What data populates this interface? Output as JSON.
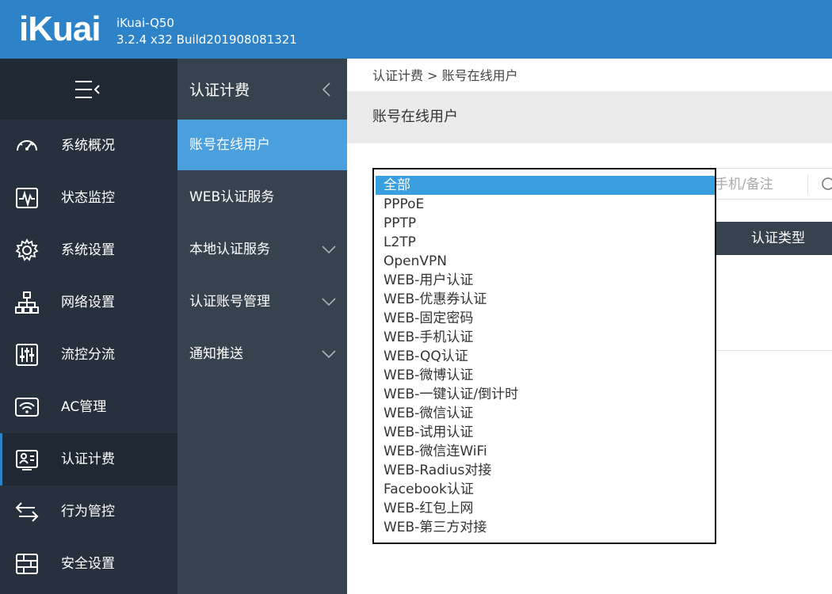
{
  "header": {
    "logo": "iKuai",
    "model": "iKuai-Q50",
    "build": "3.2.4 x32 Build201908081321",
    "bg_color": "#2e82c8"
  },
  "sidebar": {
    "toggle_icon": "menu-collapse-icon",
    "items": [
      {
        "label": "系统概况",
        "icon": "dashboard-icon"
      },
      {
        "label": "状态监控",
        "icon": "monitor-icon"
      },
      {
        "label": "系统设置",
        "icon": "gear-icon"
      },
      {
        "label": "网络设置",
        "icon": "network-icon"
      },
      {
        "label": "流控分流",
        "icon": "sliders-icon"
      },
      {
        "label": "AC管理",
        "icon": "wifi-icon"
      },
      {
        "label": "认证计费",
        "icon": "id-card-icon",
        "active": true
      },
      {
        "label": "行为管控",
        "icon": "swap-arrows-icon"
      },
      {
        "label": "安全设置",
        "icon": "firewall-icon"
      }
    ]
  },
  "subnav": {
    "title": "认证计费",
    "items": [
      {
        "label": "账号在线用户",
        "active": true
      },
      {
        "label": "WEB认证服务"
      },
      {
        "label": "本地认证服务",
        "expandable": true
      },
      {
        "label": "认证账号管理",
        "expandable": true
      },
      {
        "label": "通知推送",
        "expandable": true
      }
    ]
  },
  "main": {
    "breadcrumb": "认证计费 > 账号在线用户",
    "page_title": "账号在线用户",
    "search_placeholder_visible": "手机/备注",
    "table_header_visible": "认证类型"
  },
  "dropdown": {
    "selected": "全部",
    "options": [
      "全部",
      "PPPoE",
      "PPTP",
      "L2TP",
      "OpenVPN",
      "WEB-用户认证",
      "WEB-优惠券认证",
      "WEB-固定密码",
      "WEB-手机认证",
      "WEB-QQ认证",
      "WEB-微博认证",
      "WEB-一键认证/倒计时",
      "WEB-微信认证",
      "WEB-试用认证",
      "WEB-微信连WiFi",
      "WEB-Radius对接",
      "Facebook认证",
      "WEB-红包上网",
      "WEB-第三方对接"
    ]
  }
}
